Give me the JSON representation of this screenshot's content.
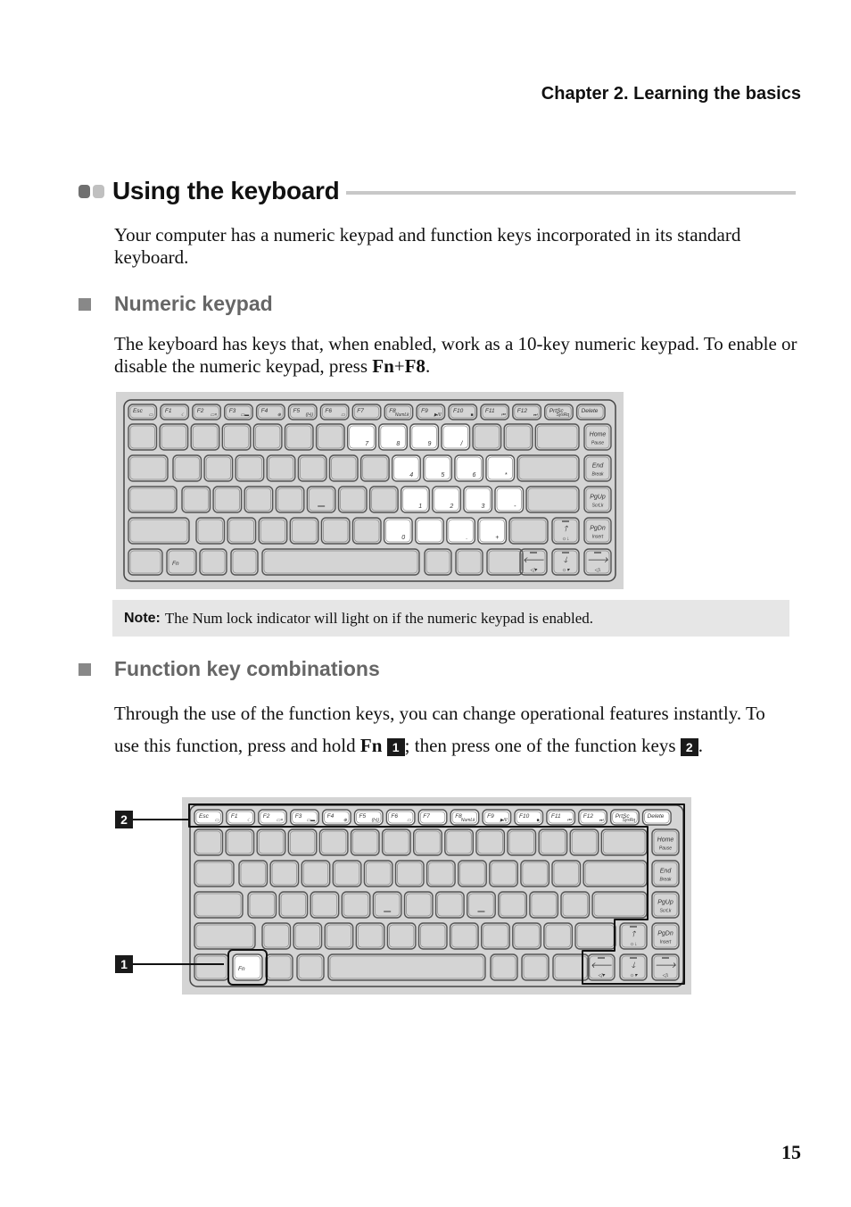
{
  "header": {
    "chapter": "Chapter 2. Learning the basics"
  },
  "section": {
    "title": "Using the keyboard",
    "intro": "Your computer has a numeric keypad and function keys incorporated in its standard keyboard.",
    "colors": {
      "dot_dark": "#707070",
      "dot_light": "#c0c0c0",
      "rule": "#c8c8c8",
      "subheading": "#666666",
      "keyboard_bg": "#d4d4d4",
      "note_bg": "#e6e6e6"
    }
  },
  "numeric_keypad": {
    "heading": "Numeric keypad",
    "text_before": "The keyboard has keys that, when enabled, work as a 10-key numeric keypad. To enable or disable the numeric keypad, press ",
    "combo_fn": "Fn",
    "combo_plus": "+",
    "combo_key": "F8",
    "text_after": ".",
    "highlighted_keys": [
      "7",
      "8",
      "9",
      "/",
      "4",
      "5",
      "6",
      "*",
      "1",
      "2",
      "3",
      "-",
      "0",
      "",
      ".",
      "+"
    ]
  },
  "note": {
    "label": "Note:",
    "text": "The Num lock indicator will light on if the numeric keypad is enabled."
  },
  "function_keys": {
    "heading": "Function key combinations",
    "text1": "Through the use of the function keys, you can change operational features instantly. To use this function, press and hold ",
    "fn_label": "Fn",
    "callout1": "1",
    "text2": "; then press one of the function keys ",
    "callout2": "2",
    "text3": "."
  },
  "keyboard": {
    "frow": [
      {
        "label": "Esc",
        "sub": "▭"
      },
      {
        "label": "F1",
        "sub": "☾"
      },
      {
        "label": "F2",
        "sub": "▭×"
      },
      {
        "label": "F3",
        "sub": "▭▬"
      },
      {
        "label": "F4",
        "sub": "⊕"
      },
      {
        "label": "F5",
        "sub": "((•))"
      },
      {
        "label": "F6",
        "sub": "▭"
      },
      {
        "label": "F7",
        "sub": ""
      },
      {
        "label": "F8",
        "sub": "NumLk"
      },
      {
        "label": "F9",
        "sub": "▶/II"
      },
      {
        "label": "F10",
        "sub": "■"
      },
      {
        "label": "F11",
        "sub": "⏮"
      },
      {
        "label": "F12",
        "sub": "⏭"
      },
      {
        "label": "PrtSc",
        "sub": "SysRq"
      },
      {
        "label": "Delete",
        "sub": ""
      }
    ],
    "right_col": [
      {
        "label": "Home",
        "sub": "Pause"
      },
      {
        "label": "End",
        "sub": "Break"
      },
      {
        "label": "PgUp",
        "sub": "ScrLk"
      },
      {
        "label": "PgDn",
        "sub": "Insert"
      }
    ],
    "fn_key": "Fn",
    "arrows": {
      "up": {
        "glyph": "🡑",
        "sub": "☼↓"
      },
      "left": {
        "glyph": "🡐",
        "sub": "◁▾"
      },
      "down": {
        "glyph": "🡓",
        "sub": "☼▾"
      },
      "right": {
        "glyph": "🡒",
        "sub": "◁↓"
      }
    }
  },
  "page_number": "15"
}
